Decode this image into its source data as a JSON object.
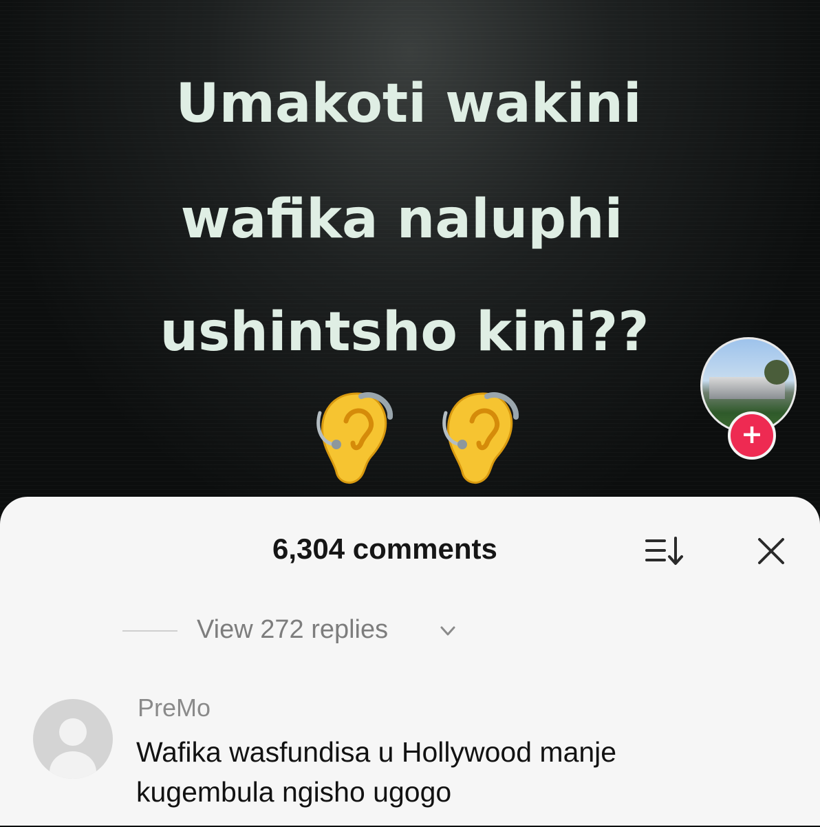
{
  "video": {
    "caption_lines": [
      "Umakoti wakini",
      "wafika naluphi",
      "ushintsho kini??"
    ],
    "emoji": [
      "ear-with-hearing-aid",
      "ear-with-hearing-aid"
    ],
    "follow_label": "+"
  },
  "comments_sheet": {
    "count_label": "6,304 comments",
    "view_replies_label": "View 272 replies",
    "comment": {
      "author": "PreMo",
      "text_lines": [
        "Wafika wasfundisa u Hollywood manje",
        "kugembula ngisho ugogo"
      ]
    }
  },
  "colors": {
    "follow_button": "#ee2a52",
    "caption_text": "#dfeee4",
    "sheet_background": "#f6f6f6"
  }
}
